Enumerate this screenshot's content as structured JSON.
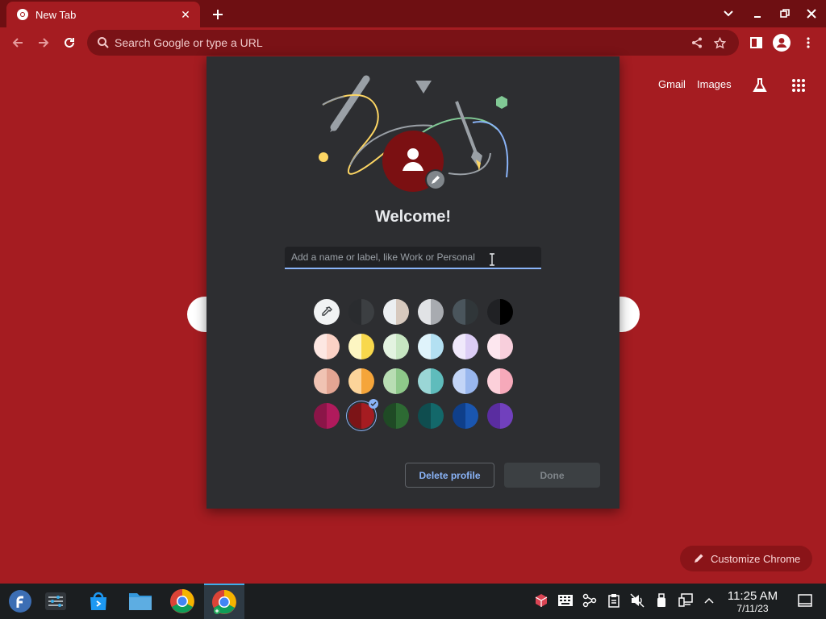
{
  "tab": {
    "title": "New Tab"
  },
  "omnibox": {
    "placeholder": "Search Google or type a URL"
  },
  "ntp": {
    "gmail": "Gmail",
    "images": "Images",
    "customize": "Customize Chrome"
  },
  "dialog": {
    "heading": "Welcome!",
    "name_placeholder": "Add a name or label, like Work or Personal",
    "delete_label": "Delete profile",
    "done_label": "Done",
    "avatar_color": "#7b1012",
    "selected_theme": "Red",
    "swatches": [
      [
        "#ffffff",
        "#ffffff"
      ],
      [
        "#2a2c2f",
        "#3c3f42"
      ],
      [
        "#eceff1",
        "#d7c9be"
      ],
      [
        "#e1e3e6",
        "#a8abb0"
      ],
      [
        "#4a555c",
        "#303639"
      ],
      [
        "#202124",
        "#000000"
      ],
      [
        "#fde7e2",
        "#fbd2c6"
      ],
      [
        "#fdf6c2",
        "#f8d84c"
      ],
      [
        "#e3f3e0",
        "#c7e6c2"
      ],
      [
        "#dff3fb",
        "#b3e0f2"
      ],
      [
        "#f0e9fb",
        "#dccdf5"
      ],
      [
        "#fde7ef",
        "#f8cfdc"
      ],
      [
        "#f0c3b3",
        "#e3a593"
      ],
      [
        "#fcd49a",
        "#f5a53a"
      ],
      [
        "#b8ddb3",
        "#8ec88a"
      ],
      [
        "#9ad6d6",
        "#5fbcbc"
      ],
      [
        "#c3d5f7",
        "#99b7ee"
      ],
      [
        "#fcd0da",
        "#f6a9ba"
      ],
      [
        "#8b1548",
        "#b01a5c"
      ],
      [
        "#7c1417",
        "#a51c21"
      ],
      [
        "#1f4a25",
        "#2d6a33"
      ],
      [
        "#0f4d4f",
        "#13686a"
      ],
      [
        "#0f3f8a",
        "#1a56b0"
      ],
      [
        "#5a2da0",
        "#7140bd"
      ]
    ]
  },
  "taskbar": {
    "time": "11:25 AM",
    "date": "7/11/23"
  },
  "colors": {
    "frame": "#6e0f12",
    "toolbar": "#a51c21",
    "dialog": "#2d2e31",
    "accent": "#8ab4f8"
  }
}
